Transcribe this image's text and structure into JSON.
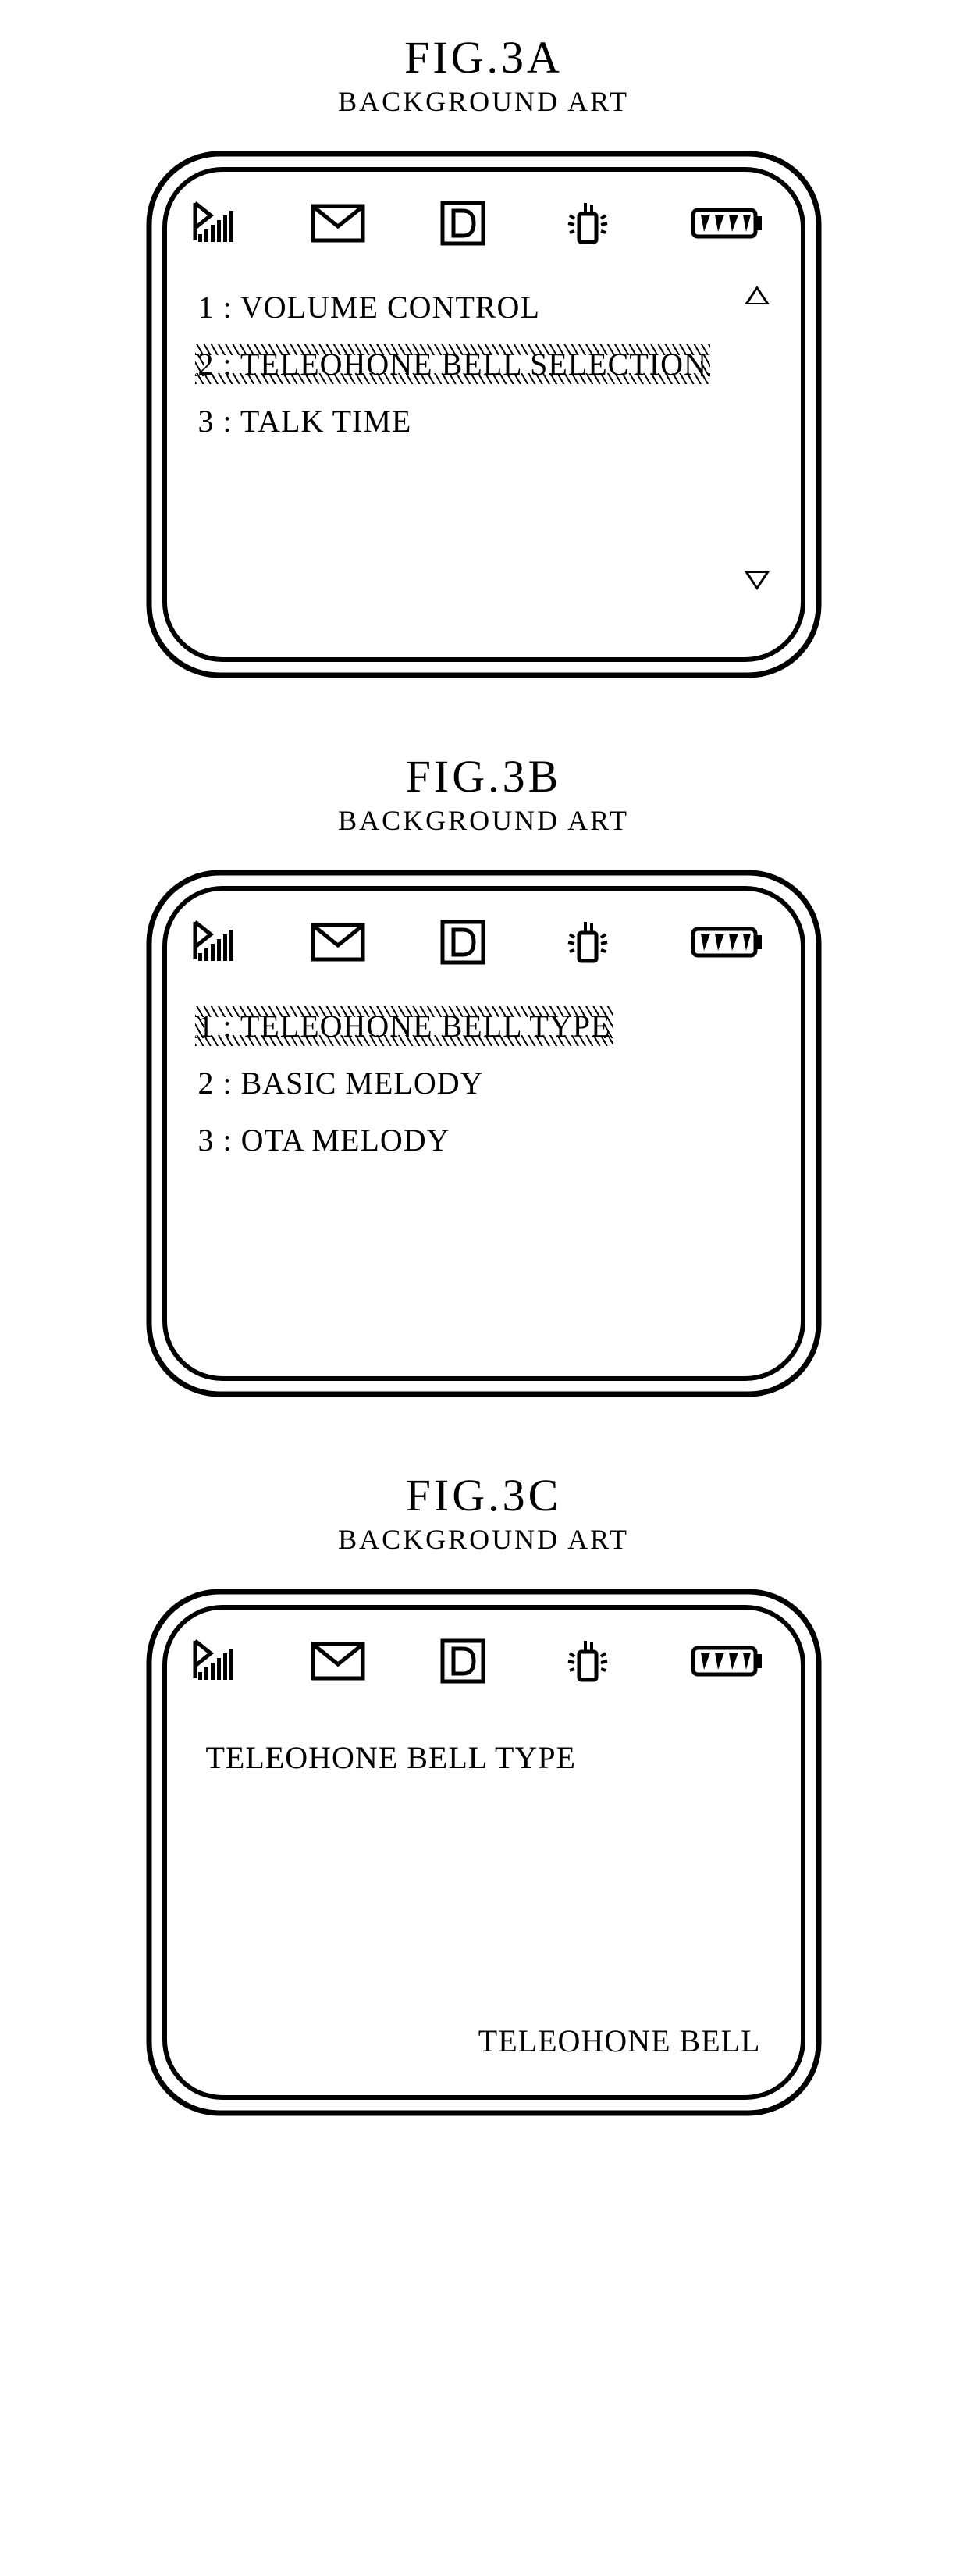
{
  "figures": {
    "a": {
      "title": "FIG.3A",
      "subtitle": "BACKGROUND ART"
    },
    "b": {
      "title": "FIG.3B",
      "subtitle": "BACKGROUND ART"
    },
    "c": {
      "title": "FIG.3C",
      "subtitle": "BACKGROUND ART"
    }
  },
  "screenA": {
    "items": [
      "1 : VOLUME CONTROL",
      "2 : TELEOHONE BELL SELECTION",
      "3 : TALK TIME"
    ],
    "selectedIndex": 1,
    "showScrollArrows": true
  },
  "screenB": {
    "items": [
      "1 : TELEOHONE BELL TYPE",
      "2 : BASIC MELODY",
      "3 : OTA MELODY"
    ],
    "selectedIndex": 0,
    "showScrollArrows": false
  },
  "screenC": {
    "heading": "TELEOHONE BELL TYPE",
    "valueLabel": "TELEOHONE BELL"
  },
  "icons": {
    "signal": "signal-icon",
    "message": "envelope-icon",
    "d": "d-square-icon",
    "vibrate": "vibrate-phone-icon",
    "battery": "battery-icon"
  }
}
